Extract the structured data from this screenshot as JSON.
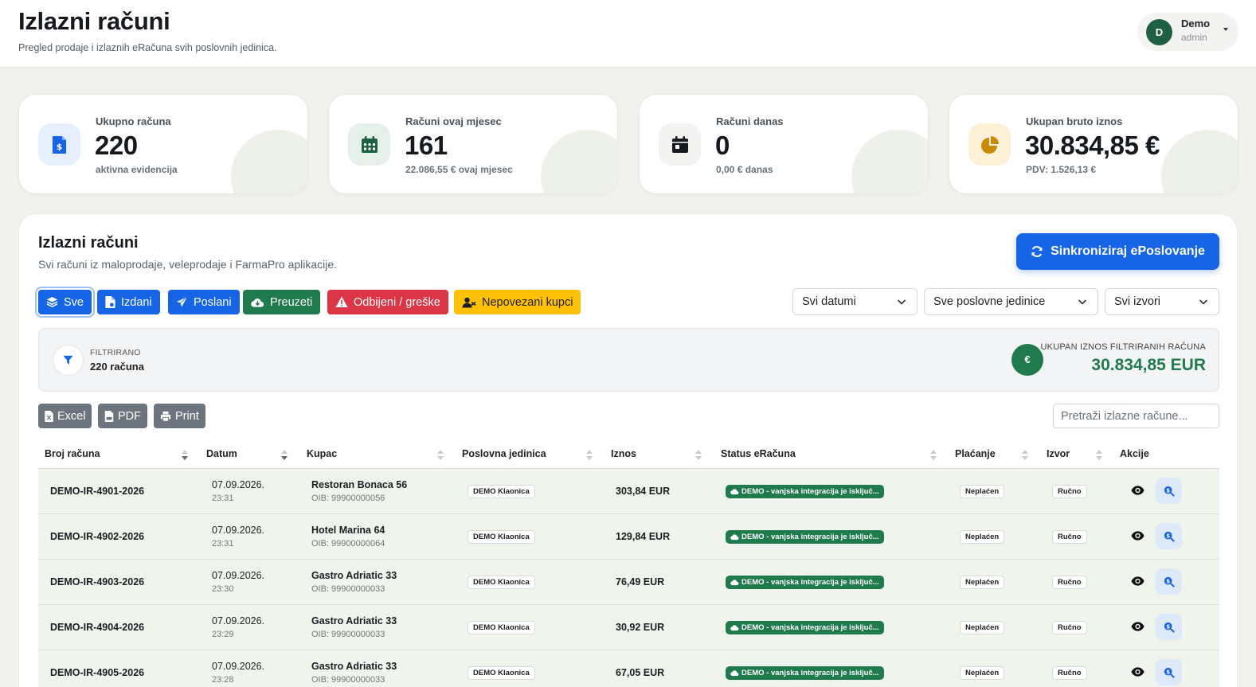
{
  "header": {
    "title": "Izlazni računi",
    "subtitle": "Pregled prodaje i izlaznih eRačuna svih poslovnih jedinica.",
    "user": {
      "initial": "D",
      "name": "Demo",
      "role": "admin"
    }
  },
  "stats": [
    {
      "label": "Ukupno računa",
      "value": "220",
      "sub": "aktivna evidencija",
      "icon": "invoice-dollar-icon",
      "accent": "#1565e6"
    },
    {
      "label": "Računi ovaj mjesec",
      "value": "161",
      "sub": "22.086,55 € ovaj mjesec",
      "icon": "calendar-grid-icon",
      "accent": "#1f5f42"
    },
    {
      "label": "Računi danas",
      "value": "0",
      "sub": "0,00 € danas",
      "icon": "calendar-day-icon",
      "accent": "#161a1e"
    },
    {
      "label": "Ukupan bruto iznos",
      "value": "30.834,85 €",
      "sub": "PDV: 1.526,13 €",
      "icon": "pie-chart-icon",
      "accent": "#c98a0a"
    }
  ],
  "section": {
    "title": "Izlazni računi",
    "subtitle": "Svi računi iz maloprodaje, veleprodaje i FarmaPro aplikacije.",
    "sync_label": "Sinkroniziraj ePoslovanje"
  },
  "filters": {
    "buttons": [
      {
        "label": "Sve",
        "icon": "layers-icon",
        "color": "#1565e6",
        "active": true
      },
      {
        "label": "Izdani",
        "icon": "file-icon",
        "color": "#1565e6",
        "active": false
      },
      {
        "label": "Poslani",
        "icon": "paper-plane-icon",
        "color": "#1565e6",
        "active": false
      },
      {
        "label": "Preuzeti",
        "icon": "cloud-download-icon",
        "color": "#1f7a4d",
        "active": false
      },
      {
        "label": "Odbijeni / greške",
        "icon": "warning-icon",
        "color": "#dc3545",
        "active": false
      },
      {
        "label": "Nepovezani kupci",
        "icon": "user-slash-icon",
        "color": "#ffc107",
        "active": false
      }
    ],
    "date_select": "Svi datumi",
    "unit_select": "Sve poslovne jedinice",
    "source_select": "Svi izvori"
  },
  "summary": {
    "filtered_label": "FILTRIRANO",
    "filtered_count": "220 računa",
    "currency_symbol": "€",
    "total_label": "UKUPAN IZNOS FILTRIRANIH RAČUNA",
    "total_value": "30.834,85 EUR"
  },
  "export": {
    "excel": "Excel",
    "pdf": "PDF",
    "print": "Print"
  },
  "search": {
    "placeholder": "Pretraži izlazne račune..."
  },
  "table": {
    "columns": [
      "Broj računa",
      "Datum",
      "Kupac",
      "Poslovna jedinica",
      "Iznos",
      "Status eRačuna",
      "Plaćanje",
      "Izvor",
      "Akcije"
    ],
    "rows": [
      {
        "number": "DEMO-IR-4901-2026",
        "date": "07.09.2026.",
        "time": "23:31",
        "customer": "Restoran Bonaca 56",
        "oib": "OIB: 99900000056",
        "unit": "DEMO Klaonica",
        "amount": "303,84 EUR",
        "status": "DEMO - vanjska integracija je isključ...",
        "payment": "Neplaćen",
        "source": "Ručno"
      },
      {
        "number": "DEMO-IR-4902-2026",
        "date": "07.09.2026.",
        "time": "23:31",
        "customer": "Hotel Marina 64",
        "oib": "OIB: 99900000064",
        "unit": "DEMO Klaonica",
        "amount": "129,84 EUR",
        "status": "DEMO - vanjska integracija je isključ...",
        "payment": "Neplaćen",
        "source": "Ručno"
      },
      {
        "number": "DEMO-IR-4903-2026",
        "date": "07.09.2026.",
        "time": "23:30",
        "customer": "Gastro Adriatic 33",
        "oib": "OIB: 99900000033",
        "unit": "DEMO Klaonica",
        "amount": "76,49 EUR",
        "status": "DEMO - vanjska integracija je isključ...",
        "payment": "Neplaćen",
        "source": "Ručno"
      },
      {
        "number": "DEMO-IR-4904-2026",
        "date": "07.09.2026.",
        "time": "23:29",
        "customer": "Gastro Adriatic 33",
        "oib": "OIB: 99900000033",
        "unit": "DEMO Klaonica",
        "amount": "30,92 EUR",
        "status": "DEMO - vanjska integracija je isključ...",
        "payment": "Neplaćen",
        "source": "Ručno"
      },
      {
        "number": "DEMO-IR-4905-2026",
        "date": "07.09.2026.",
        "time": "23:28",
        "customer": "Gastro Adriatic 33",
        "oib": "OIB: 99900000033",
        "unit": "DEMO Klaonica",
        "amount": "67,05 EUR",
        "status": "DEMO - vanjska integracija je isključ...",
        "payment": "Neplaćen",
        "source": "Ručno"
      }
    ]
  }
}
